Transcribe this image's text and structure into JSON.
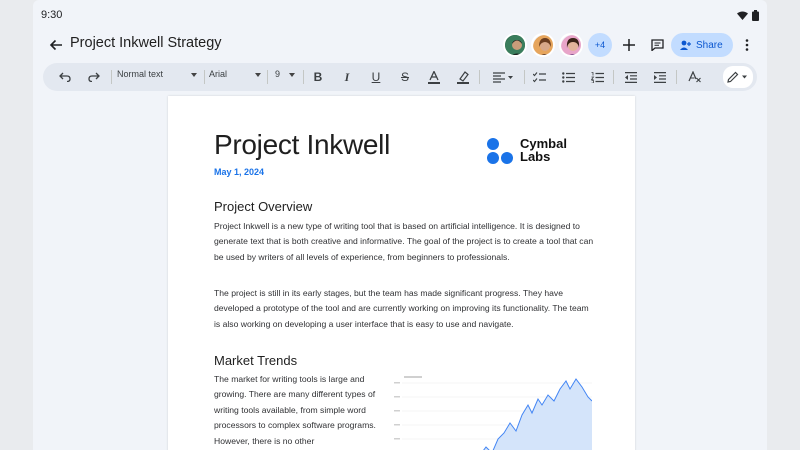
{
  "status": {
    "time": "9:30"
  },
  "header": {
    "title": "Project Inkwell Strategy",
    "extra_collaborators": "+4",
    "share_label": "Share"
  },
  "toolbar": {
    "style": "Normal text",
    "font": "Arial",
    "size": "9"
  },
  "document": {
    "title": "Project Inkwell",
    "date": "May 1, 2024",
    "logo_line1": "Cymbal",
    "logo_line2": "Labs",
    "section1_heading": "Project Overview",
    "section1_p1": "Project Inkwell is a new type of writing tool that is based on artificial intelligence. It is designed to generate text that is both creative and informative. The goal of the project is to create a tool that can be used by writers of all levels of experience, from beginners to professionals.",
    "section1_p2": "The project is still in its early stages, but the team has made significant progress. They have developed a prototype of the tool and are currently working on improving its functionality. The team is also working on developing a user interface that is easy to use and navigate.",
    "section2_heading": "Market Trends",
    "section2_p1": "The market for writing tools is large and growing. There are many different types of writing tools available, from simple word processors to complex software programs. However, there is no other"
  },
  "colors": {
    "accent": "#0b57d0",
    "share_bg": "#c2dcff",
    "logo_blue": "#1a73e8"
  }
}
